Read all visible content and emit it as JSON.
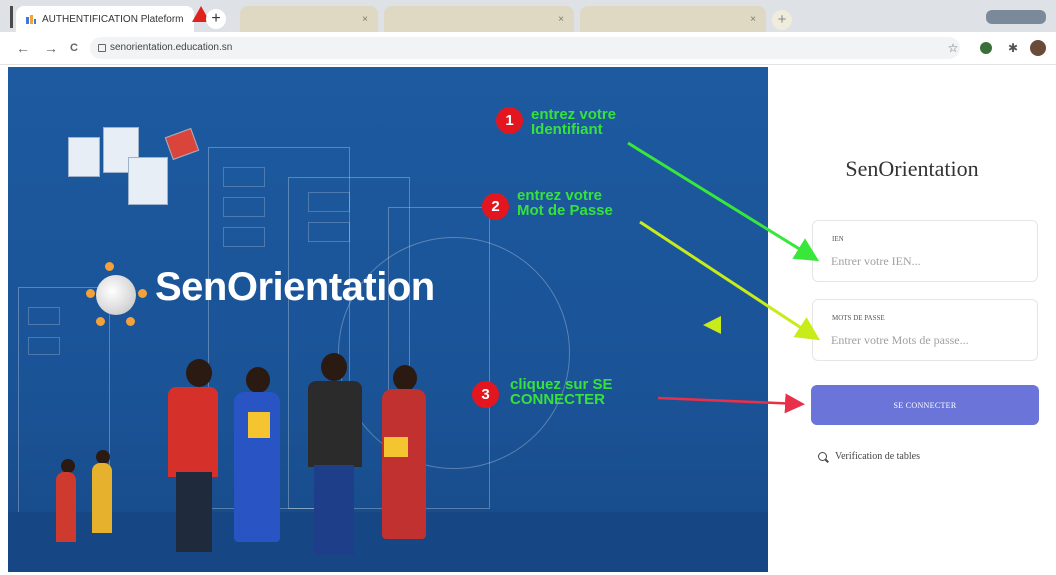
{
  "browser": {
    "active_tab_title": "AUTHENTIFICATION Plateforme Ori",
    "inactive_tabs": [
      "",
      "",
      "",
      ""
    ],
    "new_tab_symbol": "+",
    "url": "senorientation.education.sn",
    "nav": {
      "back": "←",
      "forward": "→",
      "reload": "C"
    },
    "icons": {
      "star": "☆",
      "puzzle": "✱"
    }
  },
  "hero": {
    "brand_name": "SenOrientation",
    "colors": {
      "background": "#1d5aa0",
      "annotation_green": "#36e23a",
      "step_red": "#e3161f"
    }
  },
  "annotations": [
    {
      "number": "1",
      "line1": "entrez votre",
      "line2": "Identifiant"
    },
    {
      "number": "2",
      "line1": "entrez votre",
      "line2": "Mot de Passe"
    },
    {
      "number": "3",
      "line1": "cliquez sur SE",
      "line2": "CONNECTER"
    }
  ],
  "login": {
    "title": "SenOrientation",
    "ien_label": "IEN",
    "ien_placeholder": "Entrer votre IEN...",
    "password_label": "MOTS DE PASSE",
    "password_placeholder": "Entrer votre Mots de passe...",
    "submit_label": "SE CONNECTER",
    "verify_link": "Verification de tables",
    "colors": {
      "button": "#6b74d9"
    }
  }
}
